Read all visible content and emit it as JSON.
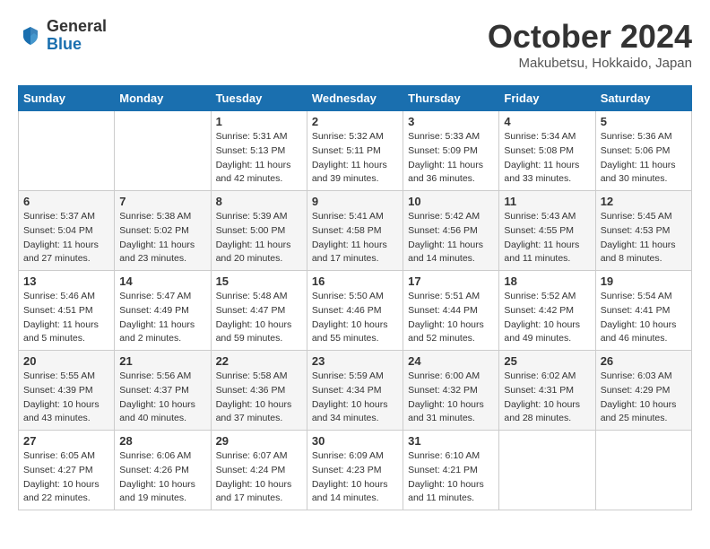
{
  "logo": {
    "general": "General",
    "blue": "Blue"
  },
  "title": "October 2024",
  "location": "Makubetsu, Hokkaido, Japan",
  "headers": [
    "Sunday",
    "Monday",
    "Tuesday",
    "Wednesday",
    "Thursday",
    "Friday",
    "Saturday"
  ],
  "weeks": [
    [
      {
        "day": "",
        "sunrise": "",
        "sunset": "",
        "daylight": ""
      },
      {
        "day": "",
        "sunrise": "",
        "sunset": "",
        "daylight": ""
      },
      {
        "day": "1",
        "sunrise": "Sunrise: 5:31 AM",
        "sunset": "Sunset: 5:13 PM",
        "daylight": "Daylight: 11 hours and 42 minutes."
      },
      {
        "day": "2",
        "sunrise": "Sunrise: 5:32 AM",
        "sunset": "Sunset: 5:11 PM",
        "daylight": "Daylight: 11 hours and 39 minutes."
      },
      {
        "day": "3",
        "sunrise": "Sunrise: 5:33 AM",
        "sunset": "Sunset: 5:09 PM",
        "daylight": "Daylight: 11 hours and 36 minutes."
      },
      {
        "day": "4",
        "sunrise": "Sunrise: 5:34 AM",
        "sunset": "Sunset: 5:08 PM",
        "daylight": "Daylight: 11 hours and 33 minutes."
      },
      {
        "day": "5",
        "sunrise": "Sunrise: 5:36 AM",
        "sunset": "Sunset: 5:06 PM",
        "daylight": "Daylight: 11 hours and 30 minutes."
      }
    ],
    [
      {
        "day": "6",
        "sunrise": "Sunrise: 5:37 AM",
        "sunset": "Sunset: 5:04 PM",
        "daylight": "Daylight: 11 hours and 27 minutes."
      },
      {
        "day": "7",
        "sunrise": "Sunrise: 5:38 AM",
        "sunset": "Sunset: 5:02 PM",
        "daylight": "Daylight: 11 hours and 23 minutes."
      },
      {
        "day": "8",
        "sunrise": "Sunrise: 5:39 AM",
        "sunset": "Sunset: 5:00 PM",
        "daylight": "Daylight: 11 hours and 20 minutes."
      },
      {
        "day": "9",
        "sunrise": "Sunrise: 5:41 AM",
        "sunset": "Sunset: 4:58 PM",
        "daylight": "Daylight: 11 hours and 17 minutes."
      },
      {
        "day": "10",
        "sunrise": "Sunrise: 5:42 AM",
        "sunset": "Sunset: 4:56 PM",
        "daylight": "Daylight: 11 hours and 14 minutes."
      },
      {
        "day": "11",
        "sunrise": "Sunrise: 5:43 AM",
        "sunset": "Sunset: 4:55 PM",
        "daylight": "Daylight: 11 hours and 11 minutes."
      },
      {
        "day": "12",
        "sunrise": "Sunrise: 5:45 AM",
        "sunset": "Sunset: 4:53 PM",
        "daylight": "Daylight: 11 hours and 8 minutes."
      }
    ],
    [
      {
        "day": "13",
        "sunrise": "Sunrise: 5:46 AM",
        "sunset": "Sunset: 4:51 PM",
        "daylight": "Daylight: 11 hours and 5 minutes."
      },
      {
        "day": "14",
        "sunrise": "Sunrise: 5:47 AM",
        "sunset": "Sunset: 4:49 PM",
        "daylight": "Daylight: 11 hours and 2 minutes."
      },
      {
        "day": "15",
        "sunrise": "Sunrise: 5:48 AM",
        "sunset": "Sunset: 4:47 PM",
        "daylight": "Daylight: 10 hours and 59 minutes."
      },
      {
        "day": "16",
        "sunrise": "Sunrise: 5:50 AM",
        "sunset": "Sunset: 4:46 PM",
        "daylight": "Daylight: 10 hours and 55 minutes."
      },
      {
        "day": "17",
        "sunrise": "Sunrise: 5:51 AM",
        "sunset": "Sunset: 4:44 PM",
        "daylight": "Daylight: 10 hours and 52 minutes."
      },
      {
        "day": "18",
        "sunrise": "Sunrise: 5:52 AM",
        "sunset": "Sunset: 4:42 PM",
        "daylight": "Daylight: 10 hours and 49 minutes."
      },
      {
        "day": "19",
        "sunrise": "Sunrise: 5:54 AM",
        "sunset": "Sunset: 4:41 PM",
        "daylight": "Daylight: 10 hours and 46 minutes."
      }
    ],
    [
      {
        "day": "20",
        "sunrise": "Sunrise: 5:55 AM",
        "sunset": "Sunset: 4:39 PM",
        "daylight": "Daylight: 10 hours and 43 minutes."
      },
      {
        "day": "21",
        "sunrise": "Sunrise: 5:56 AM",
        "sunset": "Sunset: 4:37 PM",
        "daylight": "Daylight: 10 hours and 40 minutes."
      },
      {
        "day": "22",
        "sunrise": "Sunrise: 5:58 AM",
        "sunset": "Sunset: 4:36 PM",
        "daylight": "Daylight: 10 hours and 37 minutes."
      },
      {
        "day": "23",
        "sunrise": "Sunrise: 5:59 AM",
        "sunset": "Sunset: 4:34 PM",
        "daylight": "Daylight: 10 hours and 34 minutes."
      },
      {
        "day": "24",
        "sunrise": "Sunrise: 6:00 AM",
        "sunset": "Sunset: 4:32 PM",
        "daylight": "Daylight: 10 hours and 31 minutes."
      },
      {
        "day": "25",
        "sunrise": "Sunrise: 6:02 AM",
        "sunset": "Sunset: 4:31 PM",
        "daylight": "Daylight: 10 hours and 28 minutes."
      },
      {
        "day": "26",
        "sunrise": "Sunrise: 6:03 AM",
        "sunset": "Sunset: 4:29 PM",
        "daylight": "Daylight: 10 hours and 25 minutes."
      }
    ],
    [
      {
        "day": "27",
        "sunrise": "Sunrise: 6:05 AM",
        "sunset": "Sunset: 4:27 PM",
        "daylight": "Daylight: 10 hours and 22 minutes."
      },
      {
        "day": "28",
        "sunrise": "Sunrise: 6:06 AM",
        "sunset": "Sunset: 4:26 PM",
        "daylight": "Daylight: 10 hours and 19 minutes."
      },
      {
        "day": "29",
        "sunrise": "Sunrise: 6:07 AM",
        "sunset": "Sunset: 4:24 PM",
        "daylight": "Daylight: 10 hours and 17 minutes."
      },
      {
        "day": "30",
        "sunrise": "Sunrise: 6:09 AM",
        "sunset": "Sunset: 4:23 PM",
        "daylight": "Daylight: 10 hours and 14 minutes."
      },
      {
        "day": "31",
        "sunrise": "Sunrise: 6:10 AM",
        "sunset": "Sunset: 4:21 PM",
        "daylight": "Daylight: 10 hours and 11 minutes."
      },
      {
        "day": "",
        "sunrise": "",
        "sunset": "",
        "daylight": ""
      },
      {
        "day": "",
        "sunrise": "",
        "sunset": "",
        "daylight": ""
      }
    ]
  ]
}
